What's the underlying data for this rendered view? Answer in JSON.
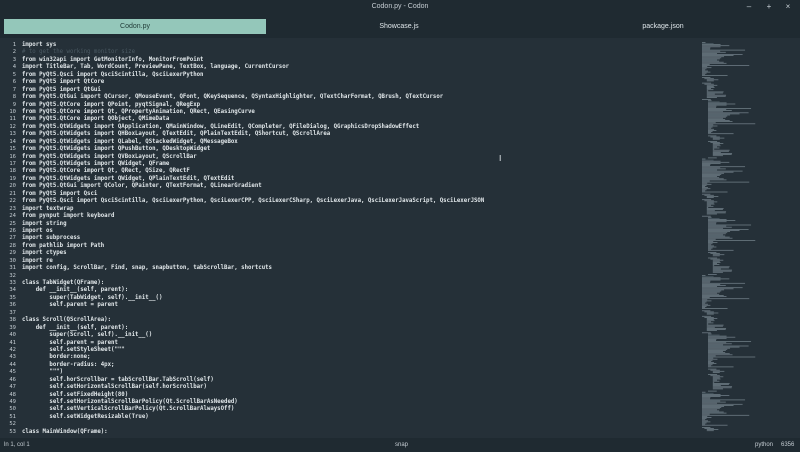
{
  "window": {
    "title": "Codon.py - Codon",
    "minimize": "–",
    "maximize": "+",
    "close": "×"
  },
  "tabs": [
    {
      "label": "Codon.py",
      "active": true
    },
    {
      "label": "Showcase.js",
      "active": false
    },
    {
      "label": "package.json",
      "active": false
    }
  ],
  "colors": {
    "accent": "#94c7ba",
    "background": "#253038",
    "chrome": "#1f2a31",
    "text": "#e1e7ea",
    "comment": "#4a5962"
  },
  "line_numbers": [
    "1",
    "2",
    "3",
    "4",
    "5",
    "6",
    "7",
    "8",
    "9",
    "10",
    "11",
    "12",
    "13",
    "14",
    "15",
    "16",
    "17",
    "18",
    "19",
    "20",
    "21",
    "22",
    "23",
    "24",
    "25",
    "26",
    "27",
    "28",
    "29",
    "30",
    "31",
    "32",
    "33",
    "34",
    "35",
    "36",
    "37",
    "38",
    "39",
    "40",
    "41",
    "42",
    "43",
    "44",
    "45",
    "46",
    "47",
    "48",
    "49",
    "50",
    "51",
    "52",
    "53"
  ],
  "code_lines": [
    "import sys",
    "# to get the working monitor size",
    "from win32api import GetMonitorInfo, MonitorFromPoint",
    "import TitleBar, Tab, WordCount, PreviewPane, TextBox, language, CurrentCursor",
    "from PyQt5.Qsci import QsciScintilla, QsciLexerPython",
    "from PyQt5 import QtCore",
    "from PyQt5 import QtGui",
    "from PyQt5.QtGui import QCursor, QMouseEvent, QFont, QKeySequence, QSyntaxHighlighter, QTextCharFormat, QBrush, QTextCursor",
    "from PyQt5.QtCore import QPoint, pyqtSignal, QRegExp",
    "from PyQt5.QtCore import Qt, QPropertyAnimation, QRect, QEasingCurve",
    "from PyQt5.QtCore import QObject, QMimeData",
    "from PyQt5.QtWidgets import QApplication, QMainWindow, QLineEdit, QCompleter, QFileDialog, QGraphicsDropShadowEffect",
    "from PyQt5.QtWidgets import QHBoxLayout, QTextEdit, QPlainTextEdit, QShortcut, QScrollArea",
    "from PyQt5.QtWidgets import QLabel, QStackedWidget, QMessageBox",
    "from PyQt5.QtWidgets import QPushButton, QDesktopWidget",
    "from PyQt5.QtWidgets import QVBoxLayout, QScrollBar",
    "from PyQt5.QtWidgets import QWidget, QFrame",
    "from PyQt5.QtCore import Qt, QRect, QSize, QRectF",
    "from PyQt5.QtWidgets import QWidget, QPlainTextEdit, QTextEdit",
    "from PyQt5.QtGui import QColor, QPainter, QTextFormat, QLinearGradient",
    "from PyQt5 import Qsci",
    "from PyQt5.Qsci import QsciScintilla, QsciLexerPython, QsciLexerCPP, QsciLexerCSharp, QsciLexerJava, QsciLexerJavaScript, QsciLexerJSON",
    "import textwrap",
    "from pynput import keyboard",
    "import string",
    "import os",
    "import subprocess",
    "from pathlib import Path",
    "import ctypes",
    "import re",
    "import config, ScrollBar, Find, snap, snapbutton, tabScrollBar, shortcuts",
    "",
    "class TabWidget(QFrame):",
    "    def __init__(self, parent):",
    "        super(TabWidget, self).__init__()",
    "        self.parent = parent",
    "",
    "class Scroll(QScrollArea):",
    "    def __init__(self, parent):",
    "        super(Scroll, self).__init__()",
    "        self.parent = parent",
    "        self.setStyleSheet(\"\"\"",
    "        border:none;",
    "        border-radius: 4px;",
    "        \"\"\")",
    "        self.horScrollbar = tabScrollBar.TabScroll(self)",
    "        self.setHorizontalScrollBar(self.horScrollbar)",
    "        self.setFixedHeight(80)",
    "        self.setHorizontalScrollBarPolicy(Qt.ScrollBarAsNeeded)",
    "        self.setVerticalScrollBarPolicy(Qt.ScrollBarAlwaysOff)",
    "        self.setWidgetResizable(True)",
    "",
    "class MainWindow(QFrame):"
  ],
  "status": {
    "position": "ln 1, col 1",
    "center": "snap",
    "language": "python",
    "count": "6356"
  }
}
